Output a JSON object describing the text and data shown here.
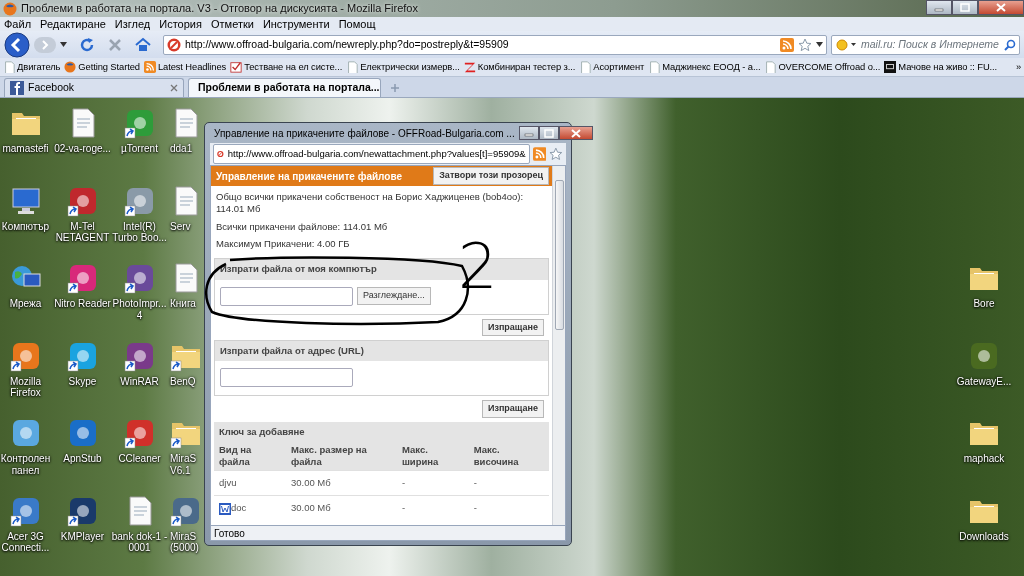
{
  "window": {
    "title": "Проблеми в работата на портала. V3 - Отговор на дискусията - Mozilla Firefox"
  },
  "menu": [
    "Файл",
    "Редактиране",
    "Изглед",
    "История",
    "Отметки",
    "Инструменти",
    "Помощ"
  ],
  "navigation": {
    "url": "http://www.offroad-bulgaria.com/newreply.php?do=postreply&t=95909",
    "search_placeholder": "mail.ru: Поиск в Интернете"
  },
  "bookmarks": [
    {
      "kind": "page",
      "label": "Двигатель"
    },
    {
      "kind": "firefox",
      "label": "Getting Started"
    },
    {
      "kind": "feed",
      "label": "Latest Headlines"
    },
    {
      "kind": "checklist",
      "label": "Тестване на ел систе..."
    },
    {
      "kind": "page",
      "label": "Електрически измерв..."
    },
    {
      "kind": "z-logo",
      "label": "Комбиниран тестер з..."
    },
    {
      "kind": "page",
      "label": "Асортимент"
    },
    {
      "kind": "page",
      "label": "Маджинекс ЕООД - а..."
    },
    {
      "kind": "page",
      "label": "OVERCOME Offroad o..."
    },
    {
      "kind": "tv",
      "label": "Мачове на живо :: FU..."
    }
  ],
  "bookmarks_more": "»",
  "tabs": [
    {
      "kind": "facebook",
      "label": "Facebook",
      "selected": false
    },
    {
      "kind": "site",
      "label": "Проблеми в работата на портала...",
      "selected": true
    }
  ],
  "desktop": {
    "left_icons": [
      {
        "kind": "folder",
        "label": "mamastefi",
        "shortcut": false
      },
      {
        "kind": "file",
        "label": "02-va-roge...",
        "shortcut": false
      },
      {
        "kind": "app",
        "label": "µTorrent",
        "shortcut": true,
        "color": "#2e9c3a"
      },
      {
        "kind": "file",
        "label": "dda1",
        "shortcut": false
      },
      {
        "kind": "computer",
        "label": "Компютър",
        "shortcut": false
      },
      {
        "kind": "app",
        "label": "M-Tel\nNETAGENT",
        "shortcut": true,
        "color": "#c0282d"
      },
      {
        "kind": "app",
        "label": "Intel(R)\nTurbo Boo...",
        "shortcut": true,
        "color": "#8a9aa8"
      },
      {
        "kind": "file",
        "label": "Serv",
        "shortcut": false
      },
      {
        "kind": "network",
        "label": "Мрежа",
        "shortcut": false
      },
      {
        "kind": "app",
        "label": "Nitro Reader",
        "shortcut": true,
        "color": "#d8287a"
      },
      {
        "kind": "app",
        "label": "PhotoImpr...\n4",
        "shortcut": true,
        "color": "#6a4a9a"
      },
      {
        "kind": "file",
        "label": "Книга",
        "shortcut": false
      },
      {
        "kind": "app",
        "label": "Mozilla\nFirefox",
        "shortcut": true,
        "color": "#e8761c"
      },
      {
        "kind": "app",
        "label": "Skype",
        "shortcut": true,
        "color": "#1aa3e0"
      },
      {
        "kind": "app",
        "label": "WinRAR",
        "shortcut": true,
        "color": "#7a3a8a"
      },
      {
        "kind": "folder",
        "label": "BenQ",
        "shortcut": true
      },
      {
        "kind": "app",
        "label": "Контролен\nпанел",
        "shortcut": false,
        "color": "#5aa8e0"
      },
      {
        "kind": "app",
        "label": "ApnStub",
        "shortcut": false,
        "color": "#1a6ec8"
      },
      {
        "kind": "app",
        "label": "CCleaner",
        "shortcut": true,
        "color": "#d0302a"
      },
      {
        "kind": "folder",
        "label": "MiraS\nV6.1",
        "shortcut": true
      },
      {
        "kind": "app",
        "label": "Acer 3G\nConnecti...",
        "shortcut": true,
        "color": "#3a7ac8"
      },
      {
        "kind": "app",
        "label": "KMPlayer",
        "shortcut": true,
        "color": "#1a3a6a"
      },
      {
        "kind": "file",
        "label": "bank dok-1 -\n0001",
        "shortcut": false
      },
      {
        "kind": "app",
        "label": "MiraS\n(5000)",
        "shortcut": true,
        "color": "#4a6a8a"
      }
    ],
    "right_icons": [
      {
        "kind": "folder",
        "label": "Bore",
        "shortcut": false
      },
      {
        "kind": "app",
        "label": "GatewayE...",
        "shortcut": false,
        "color": "#4a6a20"
      },
      {
        "kind": "folder",
        "label": "maphack",
        "shortcut": false
      },
      {
        "kind": "folder",
        "label": "Downloads",
        "shortcut": false
      }
    ]
  },
  "popup": {
    "title": "Управление на прикачените файлове - OFFRoad-Bulgaria.com ...",
    "url": "http://www.offroad-bulgaria.com/newattachment.php?values[t]=95909&",
    "heading": "Управление на прикачените файлове",
    "close_button": "Затвори този прозорец",
    "info": [
      "Общо всички прикачени собственост на Борис Хаджиценев (bob4oo): 114.01 Мб",
      "Всички прикачени файлове: 114.01 Мб",
      "Максимум Прикачени: 4.00 ГБ"
    ],
    "upload_sections": [
      {
        "kind": "file",
        "title": "Изпрати файла от моя компютър",
        "browse_button": "Разглеждане...",
        "submit_button": "Изпращане"
      },
      {
        "kind": "url",
        "title": "Изпрати файла от адрес (URL)",
        "submit_button": "Изпращане"
      }
    ],
    "key_table": {
      "title": "Ключ за добавяне",
      "columns": [
        "Вид на файла",
        "Макс. размер на файла",
        "Макс. ширина",
        "Макс. височина"
      ],
      "rows": [
        {
          "icon": false,
          "cells": [
            "djvu",
            "30.00 Мб",
            "-",
            "-"
          ]
        },
        {
          "icon": true,
          "cells": [
            "doc",
            "30.00 Мб",
            "-",
            "-"
          ]
        }
      ]
    },
    "status": "Готово"
  },
  "annotation": {
    "label": "2"
  }
}
